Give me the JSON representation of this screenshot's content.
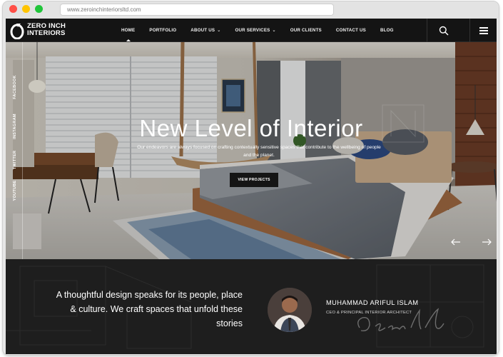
{
  "browser": {
    "url": "www.zeroinchinteriorsltd.com"
  },
  "logo": {
    "line1": "ZERO INCH",
    "line2": "INTERIORS"
  },
  "nav": {
    "items": [
      {
        "label": "HOME"
      },
      {
        "label": "PORTFOLIO"
      },
      {
        "label": "ABOUT US"
      },
      {
        "label": "OUR SERVICES"
      },
      {
        "label": "OUR CLIENTS"
      },
      {
        "label": "CONTACT US"
      },
      {
        "label": "BLOG"
      }
    ],
    "dropdown_caret": "⌄"
  },
  "hero": {
    "title": "New Level of Interior",
    "subtitle": "Our endeavors are always focused on crafting contextually sensitive spaces that contribute to the wellbeing of people and the planet.",
    "button_label": "VIEW PROJECTS"
  },
  "social": [
    "FACEBOOK",
    "INSTAGRAM",
    "TWITTER",
    "YOUTUBE"
  ],
  "about": {
    "quote": "A thoughtful design speaks for its people, place & culture. We craft spaces that unfold these stories",
    "name": "MUHAMMAD ARIFUL ISLAM",
    "role": "CEO & PRINCIPAL INTERIOR ARCHITECT",
    "signature": "Oswald"
  },
  "colors": {
    "nav_bg": "#141414",
    "accent_dark": "#151515",
    "section_bg": "#1e1e1e"
  }
}
